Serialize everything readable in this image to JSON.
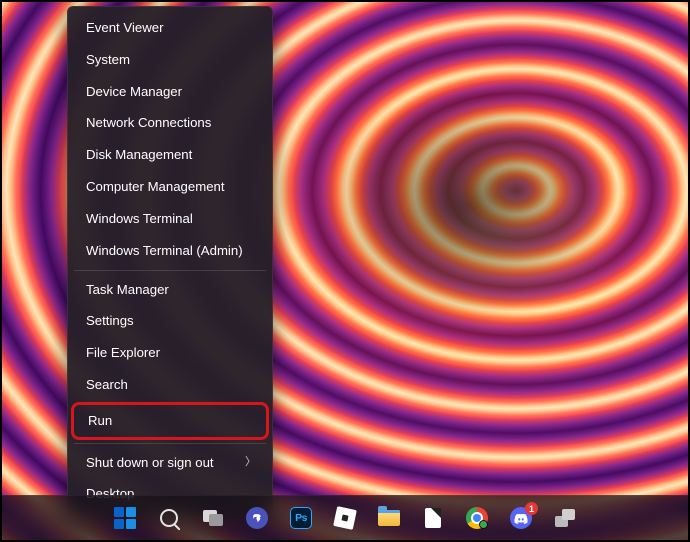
{
  "winx_menu": {
    "groups": [
      {
        "items": [
          {
            "id": "event-viewer",
            "label": "Event Viewer"
          },
          {
            "id": "system",
            "label": "System"
          },
          {
            "id": "device-manager",
            "label": "Device Manager"
          },
          {
            "id": "network-connections",
            "label": "Network Connections"
          },
          {
            "id": "disk-management",
            "label": "Disk Management"
          },
          {
            "id": "computer-management",
            "label": "Computer Management"
          },
          {
            "id": "windows-terminal",
            "label": "Windows Terminal"
          },
          {
            "id": "windows-terminal-admin",
            "label": "Windows Terminal (Admin)"
          }
        ]
      },
      {
        "items": [
          {
            "id": "task-manager",
            "label": "Task Manager"
          },
          {
            "id": "settings",
            "label": "Settings"
          },
          {
            "id": "file-explorer",
            "label": "File Explorer"
          },
          {
            "id": "search",
            "label": "Search"
          },
          {
            "id": "run",
            "label": "Run",
            "highlighted": true
          }
        ]
      },
      {
        "items": [
          {
            "id": "shut-down-or-sign-out",
            "label": "Shut down or sign out",
            "submenu": true
          },
          {
            "id": "desktop",
            "label": "Desktop"
          }
        ]
      }
    ]
  },
  "taskbar": {
    "items": [
      {
        "id": "start",
        "name": "start-button",
        "icon": "windows-logo-icon"
      },
      {
        "id": "search",
        "name": "taskbar-search",
        "icon": "search-icon"
      },
      {
        "id": "taskview",
        "name": "task-view",
        "icon": "task-view-icon"
      },
      {
        "id": "chat",
        "name": "chat-app",
        "icon": "chat-icon"
      },
      {
        "id": "photoshop",
        "name": "photoshop-app",
        "icon": "photoshop-icon",
        "label": "Ps"
      },
      {
        "id": "roblox",
        "name": "roblox-app",
        "icon": "roblox-icon"
      },
      {
        "id": "explorer",
        "name": "file-explorer-app",
        "icon": "folder-icon"
      },
      {
        "id": "file",
        "name": "document-app",
        "icon": "file-icon"
      },
      {
        "id": "chrome",
        "name": "chrome-app",
        "icon": "chrome-icon"
      },
      {
        "id": "discord",
        "name": "discord-app",
        "icon": "discord-icon",
        "badge": "1"
      },
      {
        "id": "tray",
        "name": "tray-overflow",
        "icon": "tray-stack-icon"
      }
    ]
  }
}
